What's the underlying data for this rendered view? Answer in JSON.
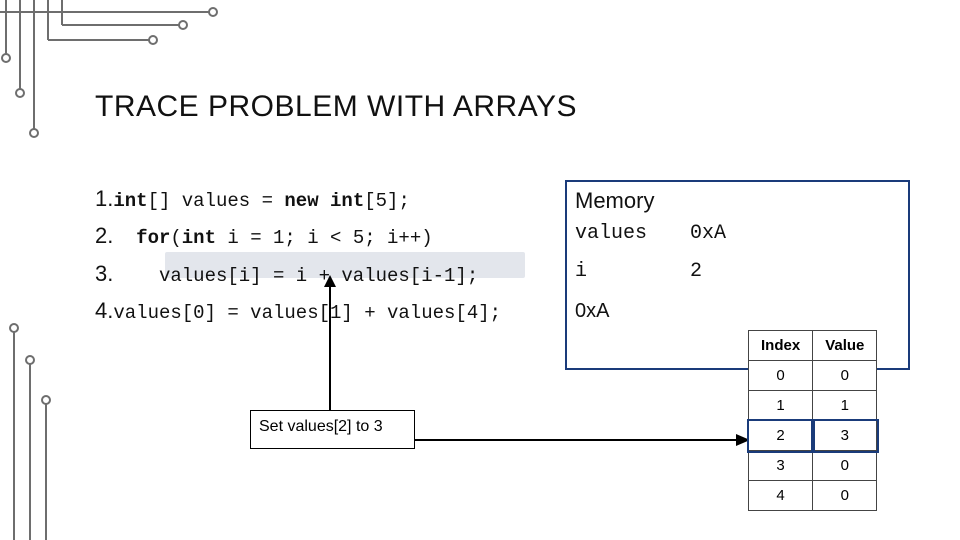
{
  "title": "TRACE PROBLEM WITH ARRAYS",
  "code": {
    "n1": "1.",
    "l1a": "int",
    "l1b": "[] values = ",
    "l1c": "new int",
    "l1d": "[5];",
    "n2": "2.",
    "l2a": "  for",
    "l2b": "(",
    "l2c": "int",
    "l2d": " i = 1; i < 5; i++)",
    "n3": "3.",
    "l3": "    values[i] = i + values[i-1];",
    "n4": "4.",
    "l4": "values[0] = values[1] + values[4];"
  },
  "memory": {
    "heading": "Memory",
    "row1_label": "values",
    "row1_value": "0xA",
    "row2_label": "i",
    "row2_value": "2",
    "pointer_label": "0xA"
  },
  "array_table": {
    "headers": [
      "Index",
      "Value"
    ],
    "rows": [
      {
        "index": "0",
        "value": "0"
      },
      {
        "index": "1",
        "value": "1"
      },
      {
        "index": "2",
        "value": "3"
      },
      {
        "index": "3",
        "value": "0"
      },
      {
        "index": "4",
        "value": "0"
      }
    ],
    "highlighted_row": 2
  },
  "callout": "Set values[2] to 3"
}
